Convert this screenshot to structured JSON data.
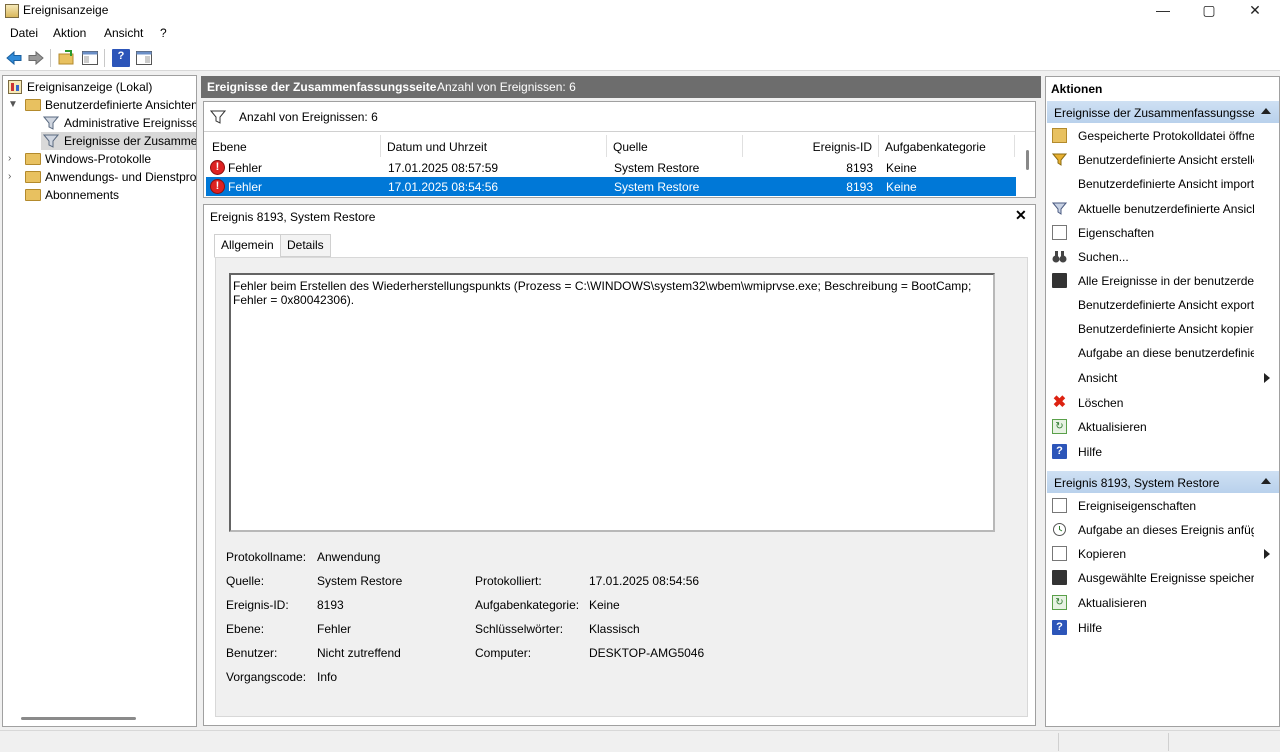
{
  "window": {
    "title": "Ereignisanzeige",
    "controls": {
      "minimize": "—",
      "maximize": "▢",
      "close": "✕"
    }
  },
  "menu": [
    "Datei",
    "Aktion",
    "Ansicht",
    "?"
  ],
  "toolbar": {
    "icons": [
      "back-arrow-icon",
      "forward-arrow-icon",
      "open-folder-icon",
      "show-hide-tree-icon",
      "help-icon",
      "show-hide-action-icon"
    ]
  },
  "tree": {
    "root": "Ereignisanzeige (Lokal)",
    "custom_views": "Benutzerdefinierte Ansichten",
    "admin_events": "Administrative Ereignisse",
    "summary_events": "Ereignisse der Zusammenfassungsseite",
    "windows_logs": "Windows-Protokolle",
    "app_service_logs": "Anwendungs- und Dienstprotokolle",
    "subscriptions": "Abonnements"
  },
  "center": {
    "header_title": "Ereignisse der Zusammenfassungsseite",
    "header_count": "Anzahl von Ereignissen: 6",
    "filter_text": "Anzahl von Ereignissen: 6",
    "columns": [
      "Ebene",
      "Datum und Uhrzeit",
      "Quelle",
      "Ereignis-ID",
      "Aufgabenkategorie"
    ],
    "rows": [
      {
        "level": "Fehler",
        "datetime": "17.01.2025 08:57:59",
        "source": "System Restore",
        "id": "8193",
        "category": "Keine"
      },
      {
        "level": "Fehler",
        "datetime": "17.01.2025 08:54:56",
        "source": "System Restore",
        "id": "8193",
        "category": "Keine"
      }
    ]
  },
  "detail": {
    "title": "Ereignis 8193, System Restore",
    "close": "✕",
    "tabs": [
      "Allgemein",
      "Details"
    ],
    "message": "Fehler beim Erstellen des Wiederherstellungspunkts (Prozess = C:\\WINDOWS\\system32\\wbem\\wmiprvse.exe; Beschreibung = BootCamp; Fehler = 0x80042306).",
    "fields": {
      "log_name_label": "Protokollname:",
      "log_name": "Anwendung",
      "source_label": "Quelle:",
      "source": "System Restore",
      "logged_label": "Protokolliert:",
      "logged": "17.01.2025 08:54:56",
      "event_id_label": "Ereignis-ID:",
      "event_id": "8193",
      "task_cat_label": "Aufgabenkategorie:",
      "task_cat": "Keine",
      "level_label": "Ebene:",
      "level": "Fehler",
      "keywords_label": "Schlüsselwörter:",
      "keywords": "Klassisch",
      "user_label": "Benutzer:",
      "user": "Nicht zutreffend",
      "computer_label": "Computer:",
      "computer": "DESKTOP-AMG5046",
      "opcode_label": "Vorgangscode:",
      "opcode": "Info"
    }
  },
  "actions": {
    "title": "Aktionen",
    "section1": "Ereignisse der Zusammenfassungsseite",
    "items1": [
      "Gespeicherte Protokolldatei öffnen...",
      "Benutzerdefinierte Ansicht erstellen...",
      "Benutzerdefinierte Ansicht importieren...",
      "Aktuelle benutzerdefinierte Ansicht filtern...",
      "Eigenschaften",
      "Suchen...",
      "Alle Ereignisse in der benutzerdefinierten Ansicht speichern unter...",
      "Benutzerdefinierte Ansicht exportieren...",
      "Benutzerdefinierte Ansicht kopieren...",
      "Aufgabe an diese benutzerdefinierte Ansicht anfügen...",
      "Ansicht",
      "Löschen",
      "Aktualisieren",
      "Hilfe"
    ],
    "section2": "Ereignis 8193, System Restore",
    "items2": [
      "Ereigniseigenschaften",
      "Aufgabe an dieses Ereignis anfügen...",
      "Kopieren",
      "Ausgewählte Ereignisse speichern...",
      "Aktualisieren",
      "Hilfe"
    ]
  },
  "colors": {
    "selection": "#0078d7",
    "header_bg": "#6d6d6d",
    "section_bg": "#c6daf0",
    "error_red": "#d22222"
  }
}
